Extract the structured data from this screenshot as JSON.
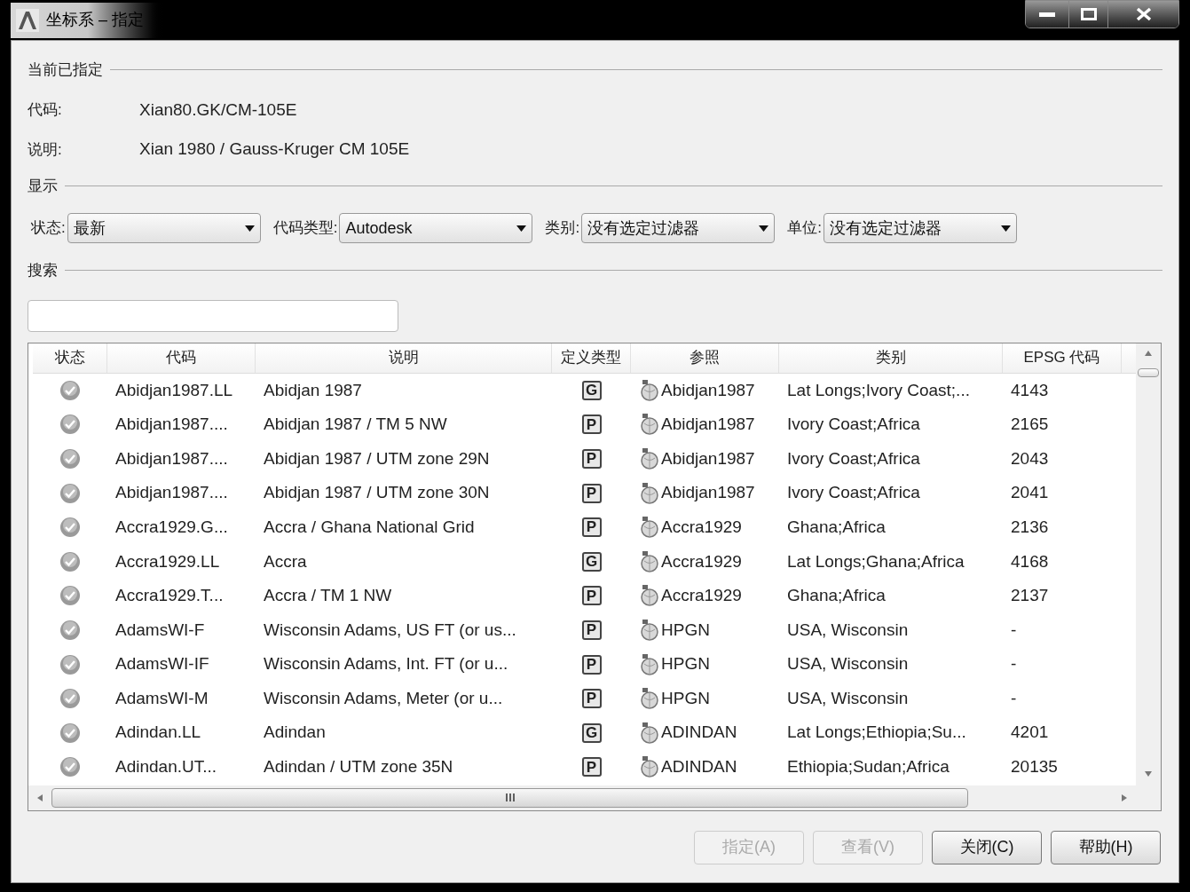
{
  "window": {
    "title": "坐标系 – 指定"
  },
  "current": {
    "heading": "当前已指定",
    "fields": [
      {
        "label": "代码:",
        "value": "Xian80.GK/CM-105E"
      },
      {
        "label": "说明:",
        "value": "Xian 1980 / Gauss-Kruger CM 105E"
      }
    ]
  },
  "display": {
    "heading": "显示",
    "filters": [
      {
        "label": "状态:",
        "value": "最新"
      },
      {
        "label": "代码类型:",
        "value": "Autodesk"
      },
      {
        "label": "类别:",
        "value": "没有选定过滤器"
      },
      {
        "label": "单位:",
        "value": "没有选定过滤器"
      }
    ]
  },
  "search": {
    "heading": "搜索"
  },
  "table": {
    "columns": [
      "状态",
      "代码",
      "说明",
      "定义类型",
      "参照",
      "类别",
      "EPSG 代码"
    ],
    "rows": [
      {
        "code": "Abidjan1987.LL",
        "description": "Abidjan 1987",
        "def_type": "G",
        "reference": "Abidjan1987",
        "category": "Lat Longs;Ivory Coast;...",
        "epsg": "4143"
      },
      {
        "code": "Abidjan1987....",
        "description": "Abidjan 1987 / TM 5 NW",
        "def_type": "P",
        "reference": "Abidjan1987",
        "category": "Ivory Coast;Africa",
        "epsg": "2165"
      },
      {
        "code": "Abidjan1987....",
        "description": "Abidjan 1987 / UTM zone 29N",
        "def_type": "P",
        "reference": "Abidjan1987",
        "category": "Ivory Coast;Africa",
        "epsg": "2043"
      },
      {
        "code": "Abidjan1987....",
        "description": "Abidjan 1987 / UTM zone 30N",
        "def_type": "P",
        "reference": "Abidjan1987",
        "category": "Ivory Coast;Africa",
        "epsg": "2041"
      },
      {
        "code": "Accra1929.G...",
        "description": "Accra / Ghana National Grid",
        "def_type": "P",
        "reference": "Accra1929",
        "category": "Ghana;Africa",
        "epsg": "2136"
      },
      {
        "code": "Accra1929.LL",
        "description": "Accra",
        "def_type": "G",
        "reference": "Accra1929",
        "category": "Lat Longs;Ghana;Africa",
        "epsg": "4168"
      },
      {
        "code": "Accra1929.T...",
        "description": "Accra / TM 1 NW",
        "def_type": "P",
        "reference": "Accra1929",
        "category": "Ghana;Africa",
        "epsg": "2137"
      },
      {
        "code": "AdamsWI-F",
        "description": "Wisconsin Adams, US FT (or us...",
        "def_type": "P",
        "reference": "HPGN",
        "category": "USA, Wisconsin",
        "epsg": "-"
      },
      {
        "code": "AdamsWI-IF",
        "description": "Wisconsin Adams, Int. FT (or u...",
        "def_type": "P",
        "reference": "HPGN",
        "category": "USA, Wisconsin",
        "epsg": "-"
      },
      {
        "code": "AdamsWI-M",
        "description": "Wisconsin Adams, Meter (or u...",
        "def_type": "P",
        "reference": "HPGN",
        "category": "USA, Wisconsin",
        "epsg": "-"
      },
      {
        "code": "Adindan.LL",
        "description": "Adindan",
        "def_type": "G",
        "reference": "ADINDAN",
        "category": "Lat Longs;Ethiopia;Su...",
        "epsg": "4201"
      },
      {
        "code": "Adindan.UT...",
        "description": "Adindan / UTM zone 35N",
        "def_type": "P",
        "reference": "ADINDAN",
        "category": "Ethiopia;Sudan;Africa",
        "epsg": "20135"
      }
    ]
  },
  "buttons": [
    {
      "label": "指定(A)",
      "disabled": true
    },
    {
      "label": "查看(V)",
      "disabled": true
    },
    {
      "label": "关闭(C)",
      "disabled": false
    },
    {
      "label": "帮助(H)",
      "disabled": false
    }
  ]
}
